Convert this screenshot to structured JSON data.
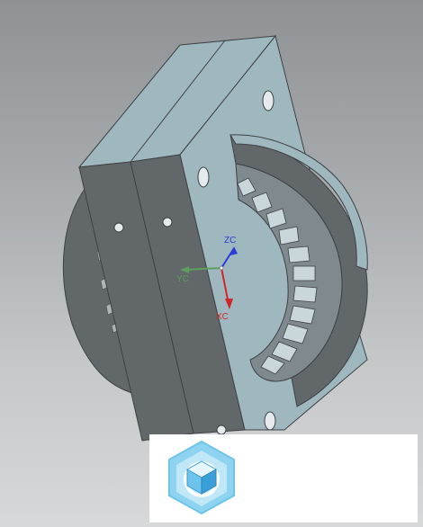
{
  "viewport": {
    "model": "cad-part-housing"
  },
  "triad": {
    "zc_label": "ZC",
    "yc_label": "YC",
    "xc_label": "XC",
    "colors": {
      "zc": "#2b3cd6",
      "yc": "#5aa05a",
      "xc": "#d0282a"
    }
  },
  "watermark": {
    "icon": "hexagon-cube-logo-icon",
    "colors": {
      "outer": "#6ec3ea",
      "inner": "#3a9ed8"
    }
  }
}
